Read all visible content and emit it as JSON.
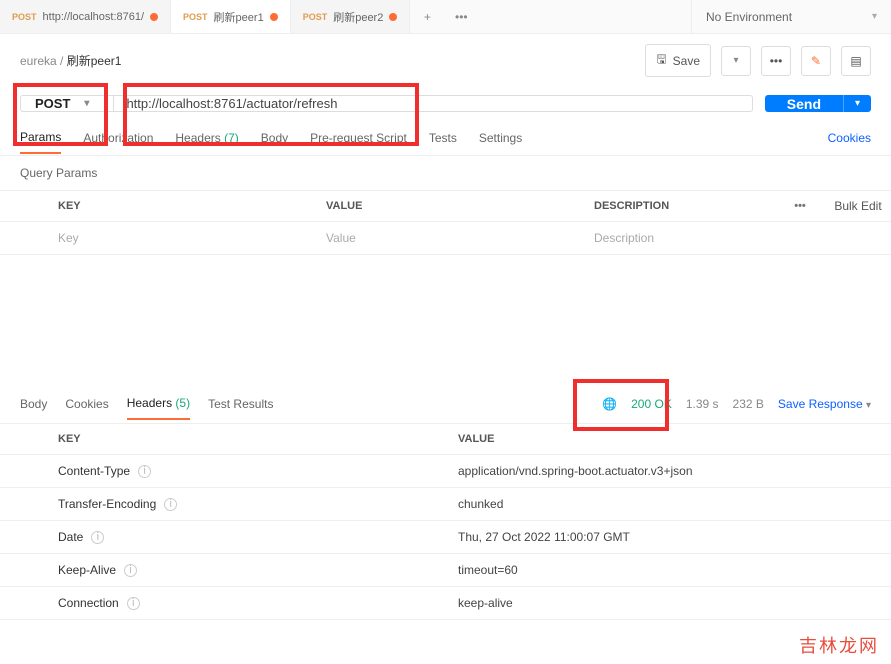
{
  "tabs": [
    {
      "method": "POST",
      "label": "http://localhost:8761/",
      "dirty": true,
      "active": false
    },
    {
      "method": "POST",
      "label": "刷新peer1",
      "dirty": true,
      "active": true
    },
    {
      "method": "POST",
      "label": "刷新peer2",
      "dirty": true,
      "active": false
    }
  ],
  "environment": "No Environment",
  "breadcrumb": {
    "root": "eureka",
    "sep": "/",
    "current": "刷新peer1"
  },
  "actions": {
    "save": "Save"
  },
  "request": {
    "method": "POST",
    "url": "http://localhost:8761/actuator/refresh",
    "send": "Send"
  },
  "reqTabs": {
    "params": "Params",
    "auth": "Authorization",
    "headers": "Headers",
    "headersCount": "(7)",
    "body": "Body",
    "prereq": "Pre-request Script",
    "tests": "Tests",
    "settings": "Settings",
    "cookies": "Cookies"
  },
  "queryParams": {
    "title": "Query Params",
    "cols": {
      "key": "KEY",
      "value": "VALUE",
      "desc": "DESCRIPTION",
      "bulk": "Bulk Edit"
    },
    "ph": {
      "key": "Key",
      "value": "Value",
      "desc": "Description"
    }
  },
  "respTabs": {
    "body": "Body",
    "cookies": "Cookies",
    "headers": "Headers",
    "headersCount": "(5)",
    "test": "Test Results"
  },
  "status": {
    "code": "200 OK",
    "time": "1.39 s",
    "size": "232 B",
    "save": "Save Response"
  },
  "respCols": {
    "key": "KEY",
    "value": "VALUE"
  },
  "respHeaders": [
    {
      "k": "Content-Type",
      "v": "application/vnd.spring-boot.actuator.v3+json"
    },
    {
      "k": "Transfer-Encoding",
      "v": "chunked"
    },
    {
      "k": "Date",
      "v": "Thu, 27 Oct 2022 11:00:07 GMT"
    },
    {
      "k": "Keep-Alive",
      "v": "timeout=60"
    },
    {
      "k": "Connection",
      "v": "keep-alive"
    }
  ],
  "watermark": "吉林龙网"
}
